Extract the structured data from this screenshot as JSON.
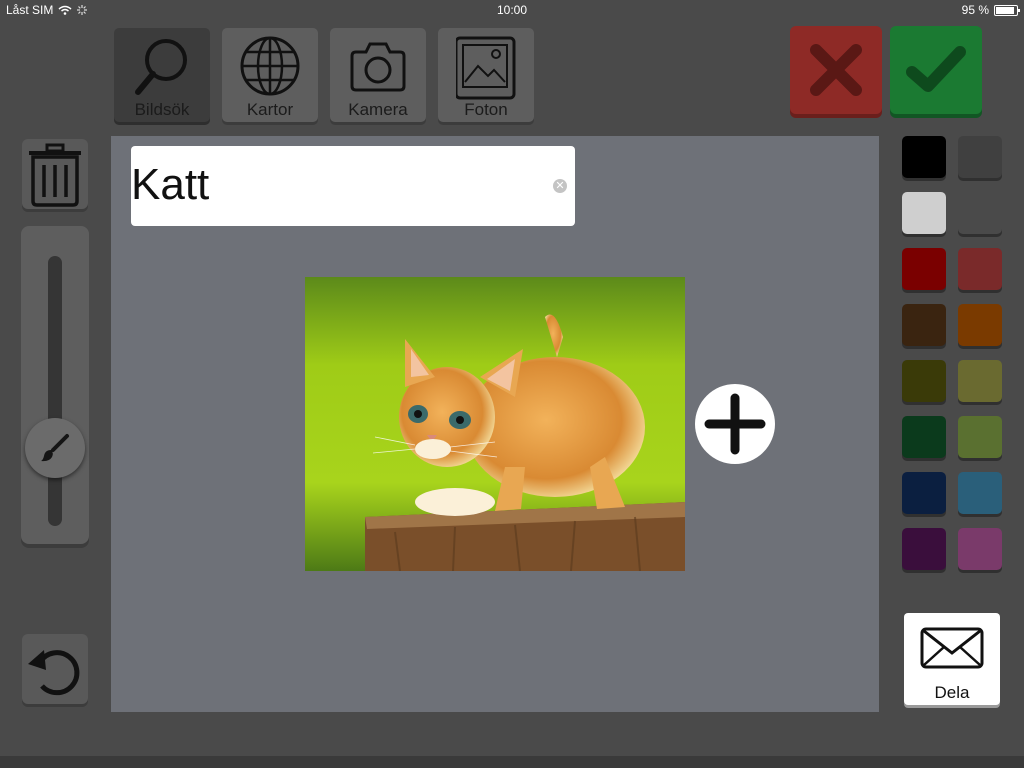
{
  "status": {
    "carrier": "Låst SIM",
    "time": "10:00",
    "battery": "95 %"
  },
  "toolbar": {
    "search": "Bildsök",
    "maps": "Kartor",
    "camera": "Kamera",
    "photos": "Foton"
  },
  "text_field": {
    "value": "Katt"
  },
  "share": {
    "label": "Dela"
  },
  "colors": [
    "#000000",
    "#404040",
    "#cfcfcf",
    "#4a4a4a",
    "#7a0000",
    "#7a2a2a",
    "#3a2410",
    "#7a3a00",
    "#3a3a08",
    "#6a6a30",
    "#0b3a1c",
    "#5a7030",
    "#0b1f40",
    "#2a5f7a",
    "#3a0e3c",
    "#7a3a6a"
  ],
  "brush_size": 0.2
}
